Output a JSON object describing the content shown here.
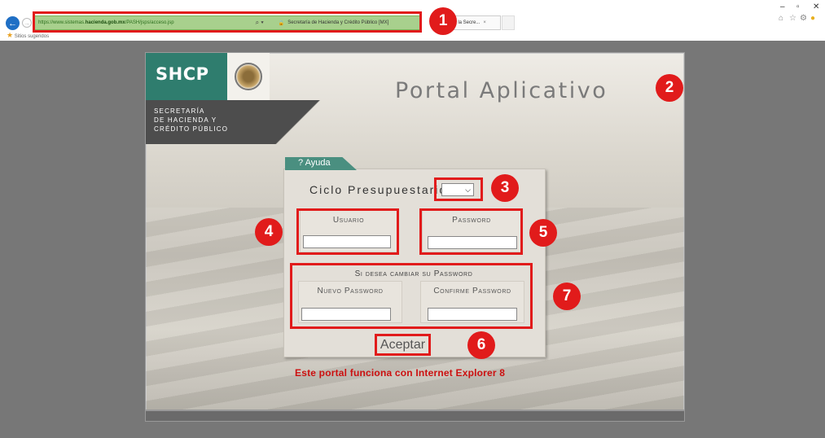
{
  "browser": {
    "url_prefix": "https://www.sistemas.",
    "url_host": "hacienda.gob.mx",
    "url_path": "/PASH/jsps/acceso.jsp",
    "site_identity": "Secretaría de Hacienda y Crédito Público [MX]",
    "tab_title": "o de la Secre...",
    "favorites_label": "Sitios sugeridos"
  },
  "header": {
    "logo_text": "SHCP",
    "agency_line1": "SECRETARÍA",
    "agency_line2": "DE HACIENDA Y",
    "agency_line3": "CRÉDITO PÚBLICO",
    "title": "Portal Aplicativo"
  },
  "form": {
    "help_tab": "? Ayuda",
    "ciclo_label": "Ciclo Presupuestario",
    "ciclo_value": "",
    "usuario_label": "Usuario",
    "password_label": "Password",
    "change_title": "Si desea cambiar su Password",
    "nuevo_label": "Nuevo Password",
    "confirme_label": "Confirme Password",
    "aceptar_label": "Aceptar",
    "ie_note": "Este portal funciona con Internet Explorer 8"
  },
  "annotations": [
    "1",
    "2",
    "3",
    "4",
    "5",
    "6",
    "7"
  ],
  "colors": {
    "annotation_red": "#e11b1b",
    "brand_green": "#2f7d6e",
    "note_red": "#cc1010"
  }
}
